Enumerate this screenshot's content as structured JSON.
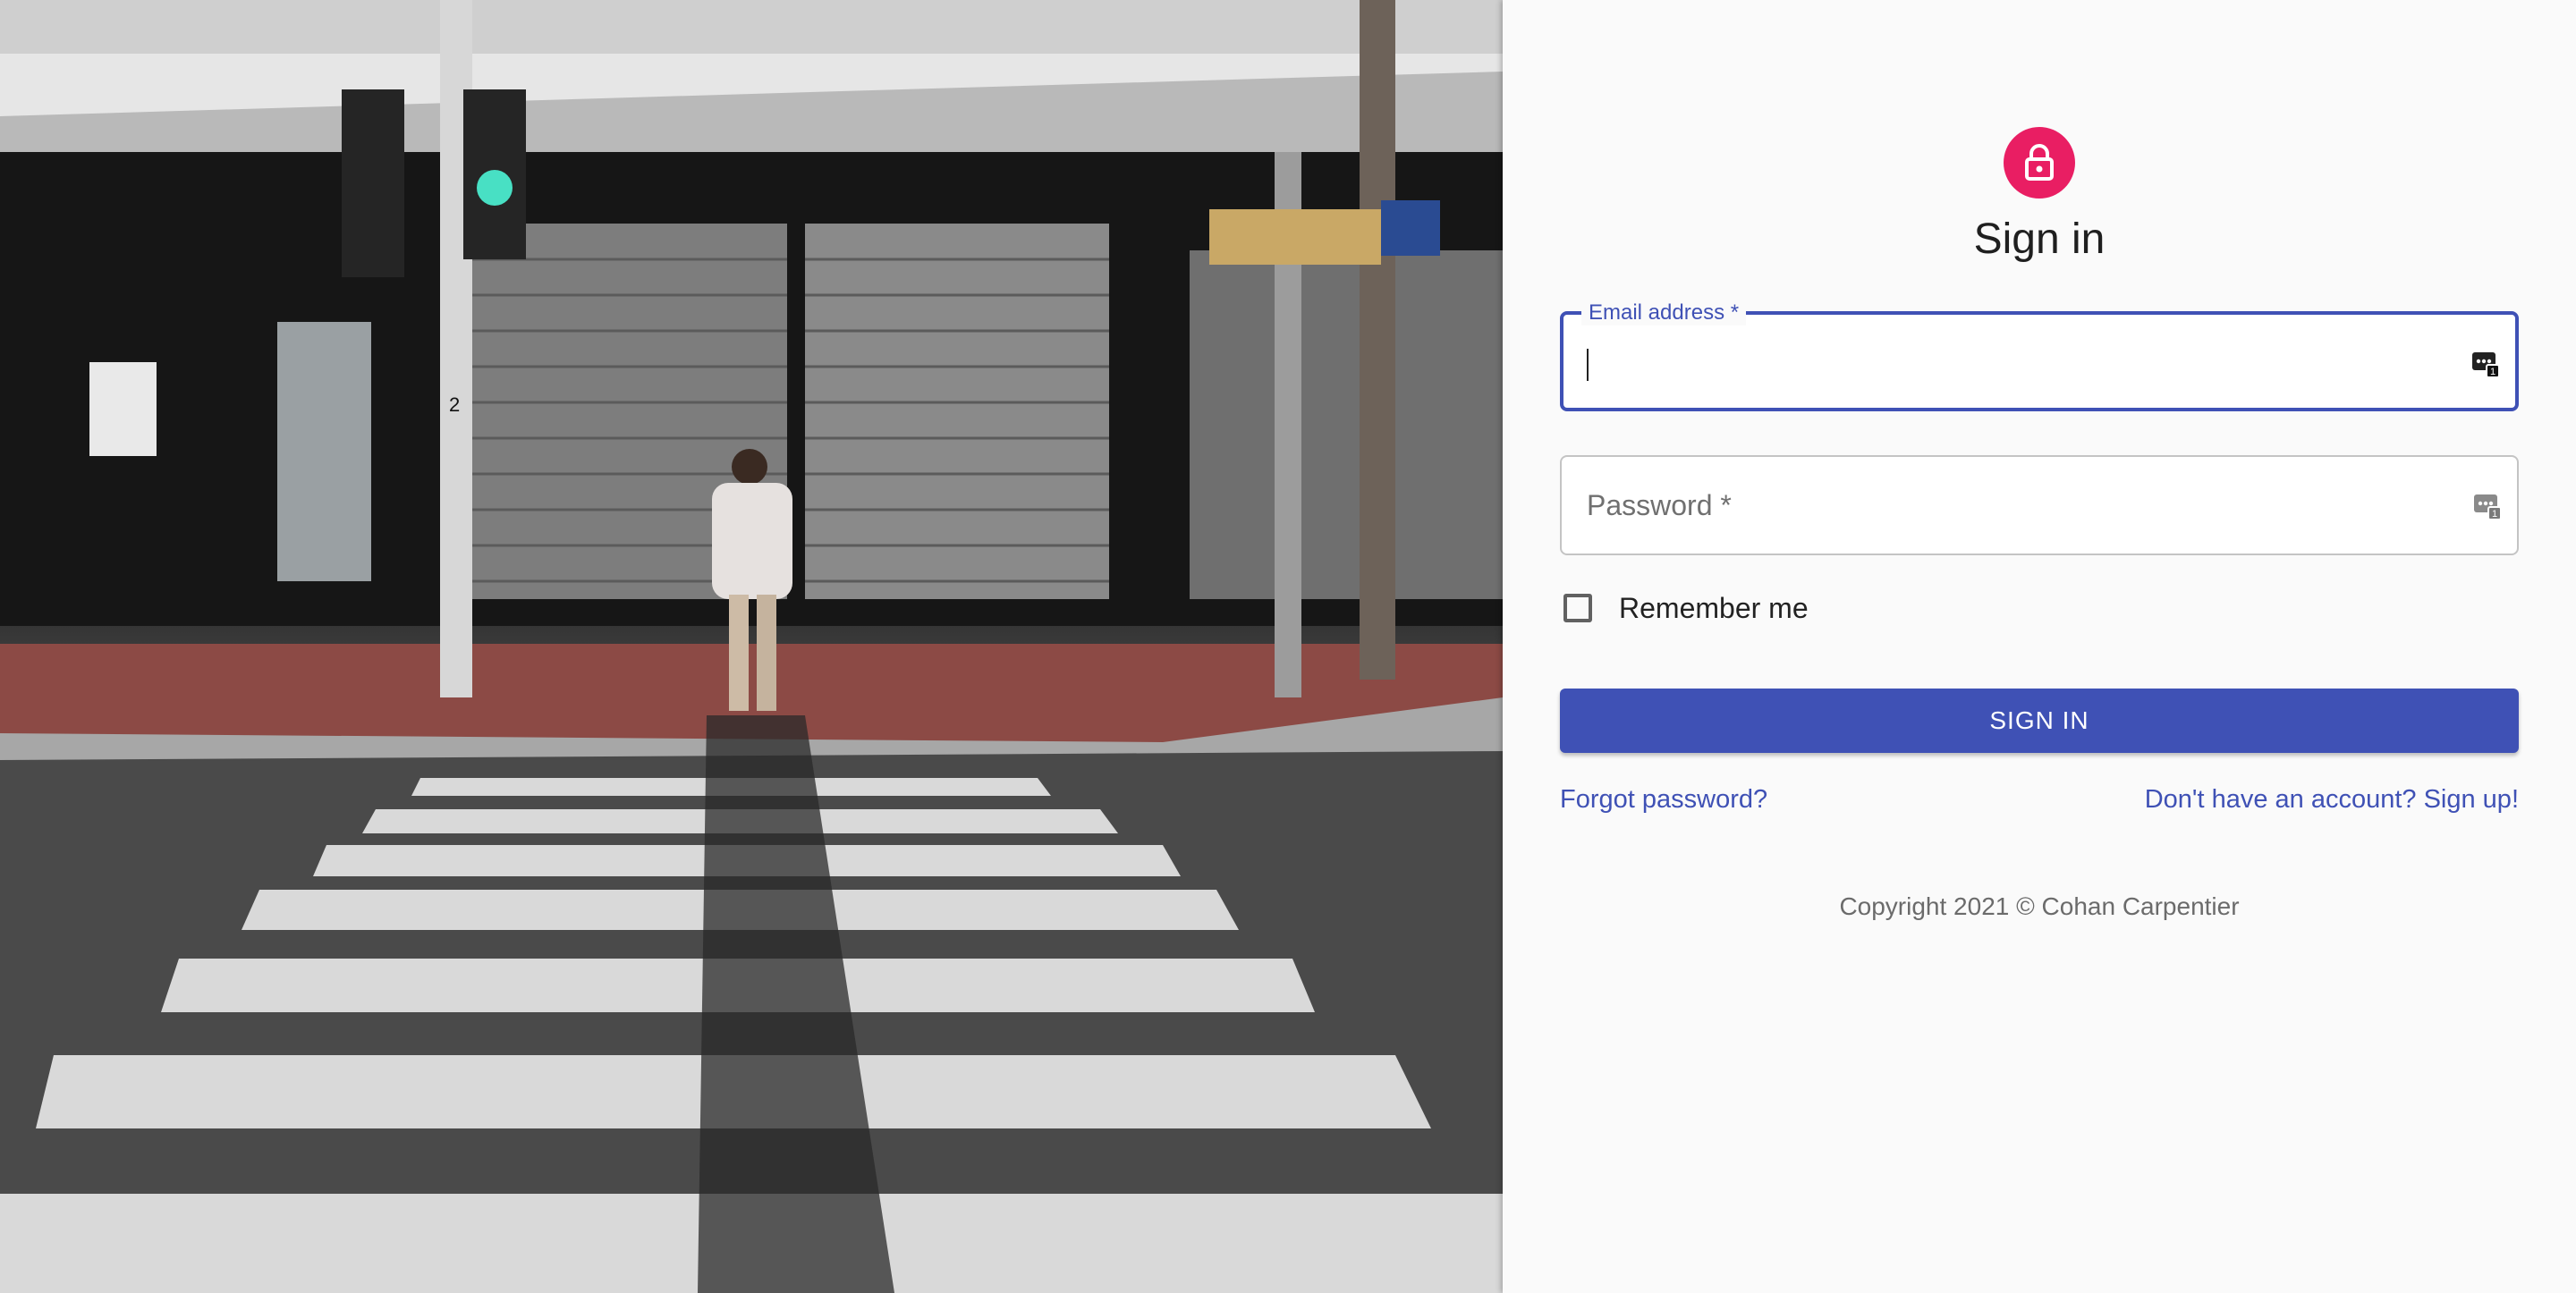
{
  "photo": {
    "alt": "Street crosswalk photo",
    "sign_number": "2"
  },
  "form": {
    "avatar_icon": "lock-icon",
    "title": "Sign in",
    "email": {
      "label": "Email address *",
      "value": "",
      "icon": "password-manager-key-icon"
    },
    "password": {
      "label": "Password *",
      "value": "",
      "icon": "password-manager-key-icon"
    },
    "remember_label": "Remember me",
    "remember_checked": false,
    "submit_label": "SIGN IN",
    "forgot_link": "Forgot password?",
    "signup_link": "Don't have an account? Sign up!",
    "copyright": "Copyright 2021 © Cohan Carpentier"
  },
  "colors": {
    "primary": "#3f51b5",
    "avatar": "#e91e63",
    "background": "#fafafa"
  }
}
